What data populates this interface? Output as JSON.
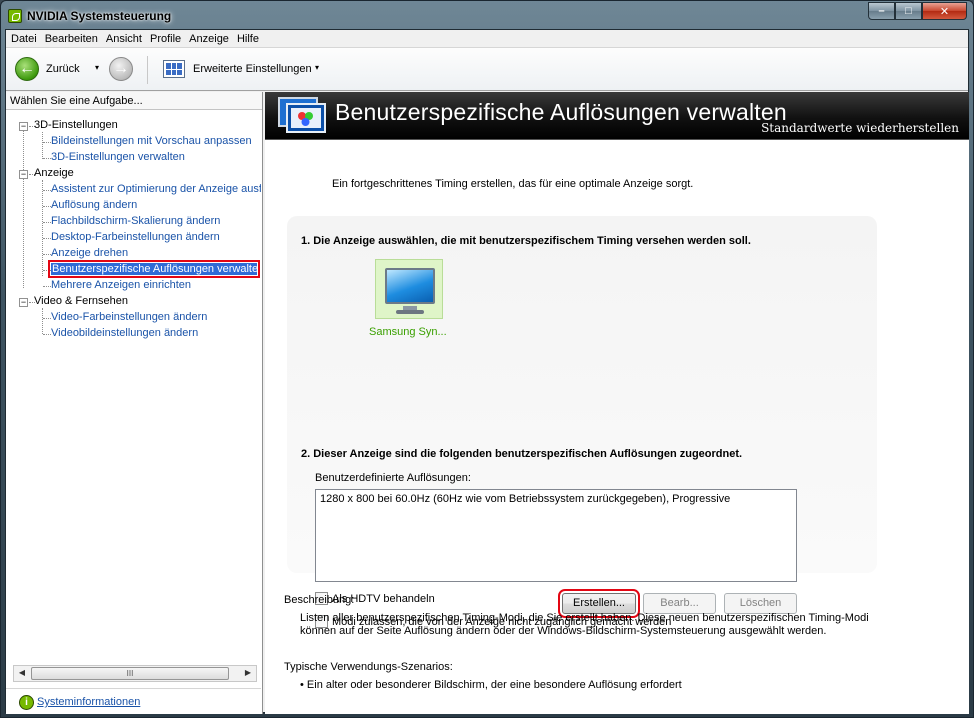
{
  "window": {
    "title": "NVIDIA Systemsteuerung",
    "controls": {
      "minimize": "–",
      "maximize": "□",
      "close": "✕"
    }
  },
  "menu": [
    "Datei",
    "Bearbeiten",
    "Ansicht",
    "Profile",
    "Anzeige",
    "Hilfe"
  ],
  "toolbar": {
    "back_label": "Zurück",
    "back_icon": "←",
    "forward_icon": "→",
    "caret": "▾",
    "advanced_label": "Erweiterte Einstellungen"
  },
  "sidebar": {
    "header": "Wählen Sie eine Aufgabe...",
    "categories": [
      {
        "label": "3D-Einstellungen",
        "expanded_symbol": "−",
        "items": [
          "Bildeinstellungen mit Vorschau anpassen",
          "3D-Einstellungen verwalten"
        ]
      },
      {
        "label": "Anzeige",
        "expanded_symbol": "−",
        "items": [
          "Assistent zur Optimierung der Anzeige ausf",
          "Auflösung ändern",
          "Flachbildschirm-Skalierung ändern",
          "Desktop-Farbeinstellungen ändern",
          "Anzeige drehen",
          "Benutzerspezifische Auflösungen verwalten",
          "Mehrere Anzeigen einrichten"
        ]
      },
      {
        "label": "Video & Fernsehen",
        "expanded_symbol": "−",
        "items": [
          "Video-Farbeinstellungen ändern",
          "Videobildeinstellungen ändern"
        ]
      }
    ],
    "scroll_left": "◀",
    "scroll_right": "▶",
    "scroll_grip": "III",
    "sysinfo_label": "Systeminformationen",
    "sysinfo_icon": "i"
  },
  "main": {
    "title": "Benutzerspezifische Auflösungen verwalten",
    "restore_link": "Standardwerte wiederherstellen",
    "intro": "Ein fortgeschrittenes Timing erstellen, das für eine optimale Anzeige sorgt.",
    "step1": "1. Die Anzeige auswählen, die mit benutzerspezifischem Timing versehen werden soll.",
    "monitor_label": "Samsung Syn...",
    "step2": "2. Dieser Anzeige sind die folgenden benutzerspezifischen Auflösungen zugeordnet.",
    "list_label": "Benutzerdefinierte Auflösungen:",
    "list_items": [
      "1280 x 800 bei 60.0Hz (60Hz wie vom Betriebssystem zurückgegeben), Progressive"
    ],
    "hdtv_label": "Als HDTV behandeln",
    "modes_label": "Modi zulassen, die von der Anzeige nicht zugänglich gemacht werden",
    "create_button": "Erstellen...",
    "edit_button": "Bearb...",
    "delete_button": "Löschen",
    "description_label": "Beschreibung:",
    "description_lines": [
      "Listen aller benutzerspezifischen Timing-Modi, die Sie erstellt haben. Diese neuen benutzerspezifischen Timing-Modi",
      "können auf der Seite Auflösung ändern oder der Windows-Bildschirm-Systemsteuerung ausgewählt werden."
    ],
    "usage_label": "Typische Verwendungs-Szenarios:",
    "usage_items": [
      "• Ein alter oder besonderer Bildschirm, der eine besondere Auflösung erfordert"
    ]
  },
  "colors": {
    "accent_green": "#76b900",
    "link_blue": "#1a53a8",
    "selection_blue": "#2f6bd6",
    "highlight_red": "#e30613"
  }
}
